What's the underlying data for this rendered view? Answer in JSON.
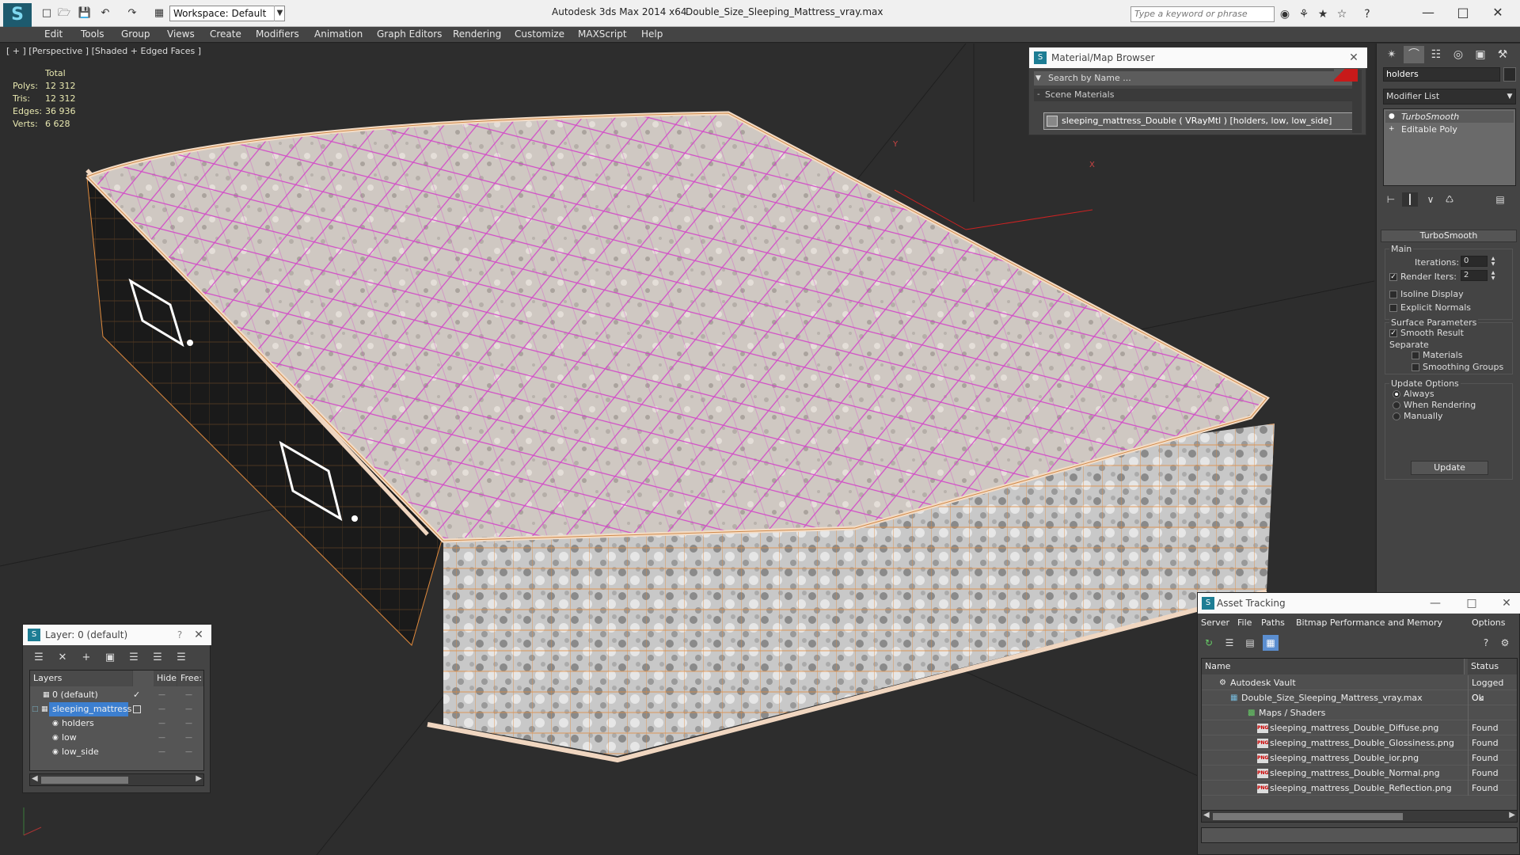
{
  "titlebar": {
    "workspace": "Workspace: Default",
    "app_title": "Autodesk 3ds Max  2014 x64",
    "file_title": "Double_Size_Sleeping_Mattress_vray.max",
    "search_placeholder": "Type a keyword or phrase"
  },
  "menu": [
    "Edit",
    "Tools",
    "Group",
    "Views",
    "Create",
    "Modifiers",
    "Animation",
    "Graph Editors",
    "Rendering",
    "Customize",
    "MAXScript",
    "Help"
  ],
  "viewport": {
    "label": "[ + ] [Perspective ] [Shaded + Edged Faces ]",
    "stats": {
      "header": "Total",
      "rows": [
        {
          "label": "Polys:",
          "value": "12 312"
        },
        {
          "label": "Tris:",
          "value": "12 312"
        },
        {
          "label": "Edges:",
          "value": "36 936"
        },
        {
          "label": "Verts:",
          "value": "6 628"
        }
      ]
    },
    "axis_y": "Y",
    "axis_x": "X",
    "colors": {
      "wire_top": "#d23cc8",
      "wire_side": "#e08a3c",
      "fabric": "#d8d2cc"
    }
  },
  "material_browser": {
    "title": "Material/Map Browser",
    "search": "Search by Name ...",
    "section": "Scene Materials",
    "item": "sleeping_mattress_Double  ( VRayMtl ) [holders, low, low_side]"
  },
  "command_panel": {
    "object_name": "holders",
    "modifier_list": "Modifier List",
    "stack": [
      "TurboSmooth",
      "Editable Poly"
    ],
    "turbosmooth": {
      "title": "TurboSmooth",
      "main": "Main",
      "iterations_label": "Iterations:",
      "iterations_value": "0",
      "render_iters_label": "Render Iters:",
      "render_iters_value": "2",
      "isoline": "Isoline Display",
      "explicit_normals": "Explicit Normals",
      "surface_params": "Surface Parameters",
      "smooth_result": "Smooth Result",
      "separate": "Separate",
      "materials": "Materials",
      "smoothing_groups": "Smoothing Groups",
      "update_options": "Update Options",
      "always": "Always",
      "when_rendering": "When Rendering",
      "manually": "Manually",
      "update": "Update"
    }
  },
  "layer_panel": {
    "title": "Layer: 0 (default)",
    "help": "?",
    "cols": {
      "layers": "Layers",
      "hide": "Hide",
      "freeze": "Free:"
    },
    "rows": [
      {
        "name": "0 (default)",
        "active": true
      },
      {
        "name": "sleeping_mattress",
        "selected": true
      },
      {
        "name": "holders"
      },
      {
        "name": "low"
      },
      {
        "name": "low_side"
      }
    ]
  },
  "asset_tracking": {
    "title": "Asset Tracking",
    "menu": [
      "Server",
      "File",
      "Paths",
      "Bitmap Performance and Memory",
      "Options"
    ],
    "cols": {
      "name": "Name",
      "status": "Status"
    },
    "rows": [
      {
        "name": "Autodesk Vault",
        "status": "Logged Ou"
      },
      {
        "name": "Double_Size_Sleeping_Mattress_vray.max",
        "status": "Ok"
      },
      {
        "name": "Maps / Shaders",
        "status": ""
      },
      {
        "name": "sleeping_mattress_Double_Diffuse.png",
        "status": "Found"
      },
      {
        "name": "sleeping_mattress_Double_Glossiness.png",
        "status": "Found"
      },
      {
        "name": "sleeping_mattress_Double_ior.png",
        "status": "Found"
      },
      {
        "name": "sleeping_mattress_Double_Normal.png",
        "status": "Found"
      },
      {
        "name": "sleeping_mattress_Double_Reflection.png",
        "status": "Found"
      }
    ],
    "png_tag": "PNG"
  }
}
